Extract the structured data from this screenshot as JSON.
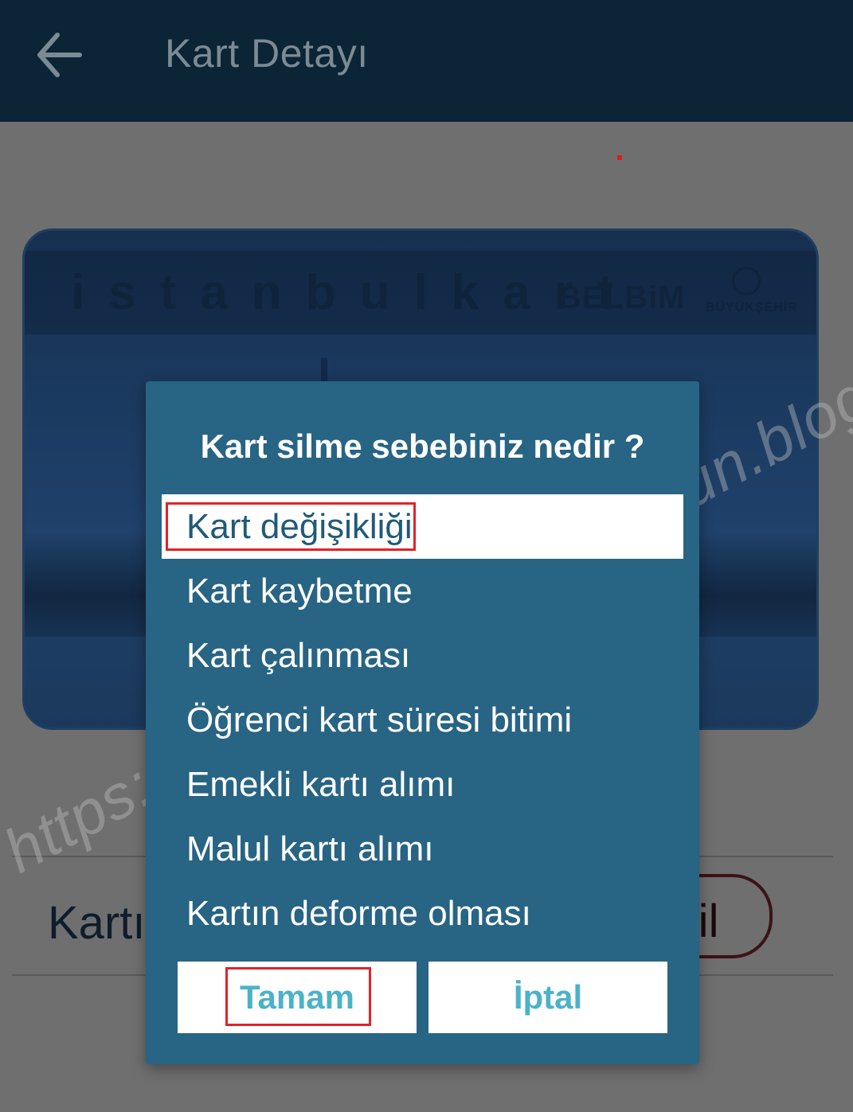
{
  "header": {
    "title": "Kart Detayı",
    "back_icon": "arrow-left-icon"
  },
  "card": {
    "brand": "istanbulkart",
    "partner": "BELBiM",
    "municipality": "BÜYÜKŞEHİR"
  },
  "background": {
    "row_label": "Kartı",
    "delete_label": "Sil"
  },
  "watermark": "https://muhammedyusufolgun.blogspot.com",
  "dialog": {
    "title": "Kart silme sebebiniz nedir ?",
    "selected_index": 0,
    "options": [
      "Kart değişikliği",
      "Kart kaybetme",
      "Kart çalınması",
      "Öğrenci kart süresi bitimi",
      "Emekli kartı alımı",
      "Malul kartı alımı",
      "Kartın deforme olması"
    ],
    "ok_label": "Tamam",
    "cancel_label": "İptal"
  },
  "colors": {
    "header_bg": "#0b2436",
    "dialog_bg": "#286483",
    "button_text": "#4bb2c9",
    "highlight": "#e0232a"
  }
}
